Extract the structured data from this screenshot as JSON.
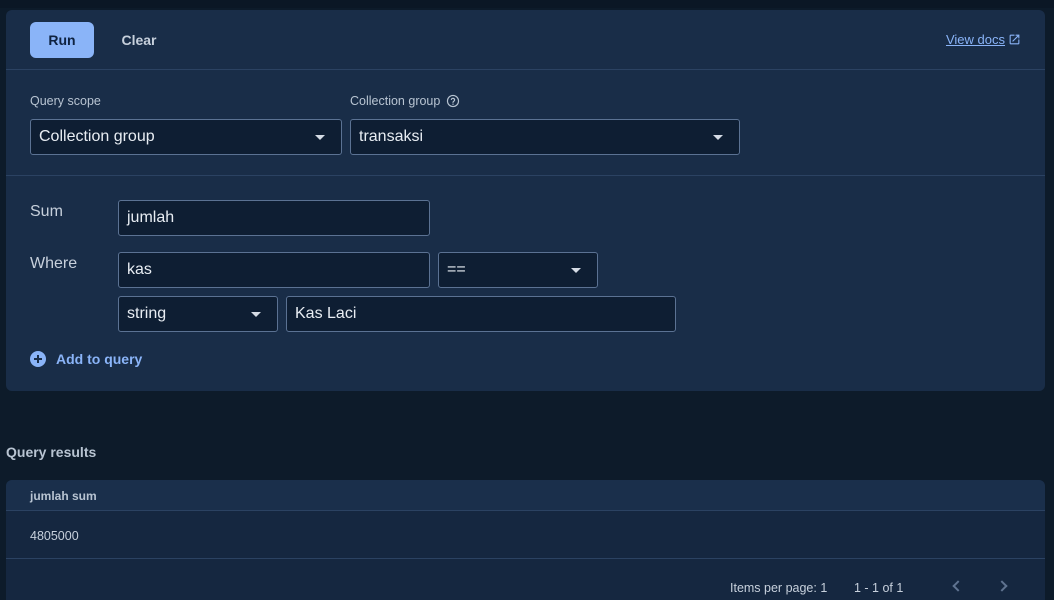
{
  "toolbar": {
    "run_label": "Run",
    "clear_label": "Clear",
    "docs_label": "View docs"
  },
  "scope": {
    "query_scope_label": "Query scope",
    "query_scope_value": "Collection group",
    "collection_group_label": "Collection group",
    "collection_group_value": "transaksi"
  },
  "query": {
    "sum_label": "Sum",
    "sum_field": "jumlah",
    "where_label": "Where",
    "where_field": "kas",
    "where_operator": "==",
    "where_type": "string",
    "where_value": "Kas Laci",
    "add_label": "Add to query"
  },
  "results": {
    "title": "Query results",
    "column": "jumlah sum",
    "value": "4805000",
    "items_per_page": "Items per page: 1",
    "range": "1 - 1 of 1"
  },
  "icons": [
    "external-link-icon",
    "help-icon",
    "chevron-down-icon",
    "add-circle-icon",
    "chevron-left-icon",
    "chevron-right-icon"
  ],
  "colors": {
    "background": "#0d1b2a",
    "panel": "#192d48",
    "accent": "#8ab4f8",
    "field": "#0e1e33"
  }
}
